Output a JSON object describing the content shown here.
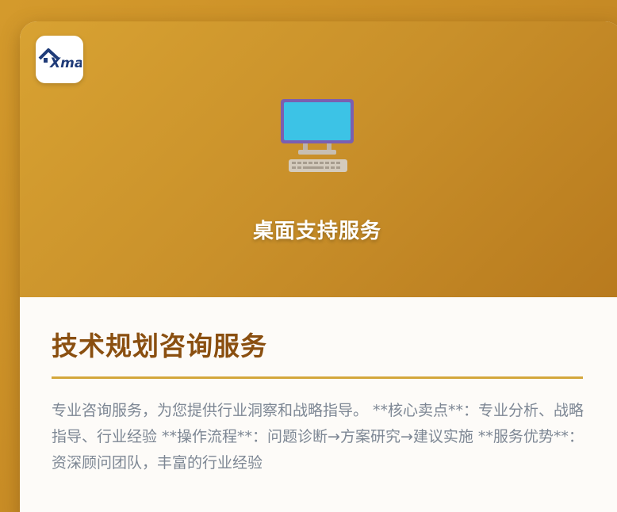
{
  "hero": {
    "logo_text": "Xmall",
    "icon": "desktop-computer-icon",
    "title": "桌面支持服务"
  },
  "content": {
    "title": "技术规划咨询服务",
    "description": "专业咨询服务，为您提供行业洞察和战略指导。 **核心卖点**：专业分析、战略指导、行业经验 **操作流程**：问题诊断→方案研究→建议实施 **服务优势**：资深顾问团队，丰富的行业经验"
  },
  "colors": {
    "background": "#c98d26",
    "title": "#8a4f10",
    "divider": "#d4a73c",
    "text": "#7d8794",
    "monitor_screen": "#3cc3e6",
    "monitor_frame": "#7b5fb0"
  }
}
